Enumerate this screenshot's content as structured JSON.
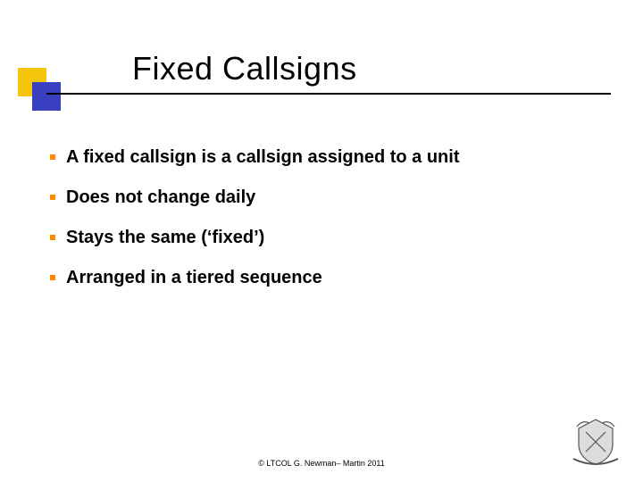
{
  "slide": {
    "title": "Fixed Callsigns",
    "bullets": [
      "A fixed callsign is a callsign assigned to a unit",
      "Does not change daily",
      "Stays the same (‘fixed’)",
      "Arranged in a tiered sequence"
    ],
    "footer": "© LTCOL G. Newman– Martin 2011"
  },
  "accent_colors": {
    "square_yellow": "#f3c40a",
    "square_blue": "#3a3fbf",
    "bullet_orange": "#ff8a00"
  }
}
